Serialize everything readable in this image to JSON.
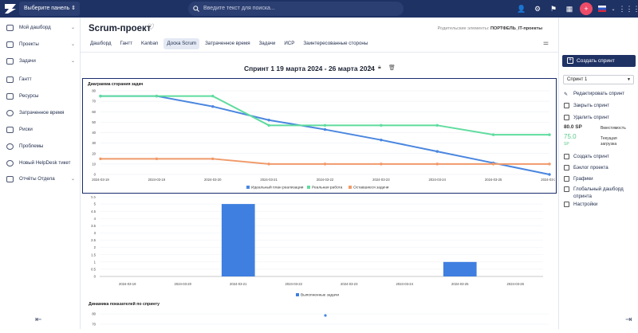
{
  "topbar": {
    "panel_select": "Выберите панель",
    "search_placeholder": "Введите текст для поиска..."
  },
  "sidebar": {
    "items": [
      {
        "label": "Мой дашборд",
        "has_chevron": true
      },
      {
        "label": "Проекты",
        "has_chevron": true
      },
      {
        "label": "Задачи",
        "has_chevron": true
      },
      {
        "label": "Гантт",
        "has_chevron": false
      },
      {
        "label": "Ресурсы",
        "has_chevron": false
      },
      {
        "label": "Затраченное время",
        "has_chevron": false
      },
      {
        "label": "Риски",
        "has_chevron": false
      },
      {
        "label": "Проблемы",
        "has_chevron": false
      },
      {
        "label": "Новый HelpDesk тикет",
        "has_chevron": false
      },
      {
        "label": "Отчёты Отдела",
        "has_chevron": true
      }
    ]
  },
  "header": {
    "title": "Scrum-проект",
    "parent_label": "Родительские элементы:",
    "parent_value": "ПОРТФЕЛЬ_IT-проекты"
  },
  "tabs": [
    "Дашборд",
    "Гантт",
    "Kanban",
    "Доска Scrum",
    "Затраченное время",
    "Задачи",
    "ИСР",
    "Заинтересованные стороны"
  ],
  "active_tab": "Доска Scrum",
  "sprint": {
    "title": "Спринт 1 19 марта 2024 - 26 марта 2024"
  },
  "right_panel": {
    "create_sprint_button": "Создать спринт",
    "sprint_select": "Спринт 1",
    "actions1": [
      "Редактировать спринт",
      "Закрыть спринт",
      "Удалить спринт"
    ],
    "sp_total": "80.0 SP",
    "capacity_label": "Вместимость",
    "sp_current": "75.0",
    "sp_unit": "SP",
    "load_label": "Текущая загрузка",
    "actions2": [
      "Создать спринт",
      "Бэклог проекта",
      "Графики",
      "Глобальный дашборд спринта",
      "Настройки"
    ]
  },
  "colors": {
    "topbar": "#1f3264",
    "ideal": "#4a86e0",
    "real": "#5fdc9e",
    "remaining": "#f09a6a",
    "bar": "#3f7fe0",
    "plus_button": "#ee4b68"
  },
  "chart_data": [
    {
      "type": "line",
      "title": "Диаграмма сгорания задач",
      "x": [
        "2024-03-19",
        "2024-03-19",
        "2024-03-20",
        "2024-03-21",
        "2024-03-22",
        "2024-03-23",
        "2024-03-24",
        "2024-03-25",
        "2024-03-26"
      ],
      "ylim": [
        0,
        80
      ],
      "yticks": [
        0,
        10,
        20,
        30,
        40,
        50,
        60,
        70,
        80
      ],
      "series": [
        {
          "name": "Идеальный план реализации",
          "values": [
            75,
            75,
            65,
            52,
            43,
            33,
            22,
            11,
            0
          ]
        },
        {
          "name": "Реальная работа",
          "values": [
            75,
            75,
            75,
            47,
            47,
            47,
            47,
            38,
            38
          ]
        },
        {
          "name": "Оставшиеся задачи",
          "values": [
            15,
            15,
            15,
            10,
            10,
            10,
            10,
            10,
            10
          ]
        }
      ],
      "legend": "bottom"
    },
    {
      "type": "bar",
      "categories": [
        "2024-03-19",
        "2024-03-20",
        "2024-03-21",
        "2024-03-22",
        "2024-03-23",
        "2024-03-24",
        "2024-03-25",
        "2024-03-26"
      ],
      "series": [
        {
          "name": "Выполненные задачи",
          "values": [
            0,
            0,
            5,
            0,
            0,
            0,
            1,
            0
          ]
        }
      ],
      "ylim": [
        0,
        5.5
      ],
      "yticks": [
        0,
        0.5,
        1,
        1.5,
        2,
        2.5,
        3,
        3.5,
        4,
        4.5,
        5,
        5.5
      ],
      "legend": "bottom"
    },
    {
      "type": "line",
      "title": "Динамика показателей по спринту",
      "ylim": [
        0,
        80
      ],
      "yticks": [
        70,
        80
      ],
      "series": []
    }
  ]
}
